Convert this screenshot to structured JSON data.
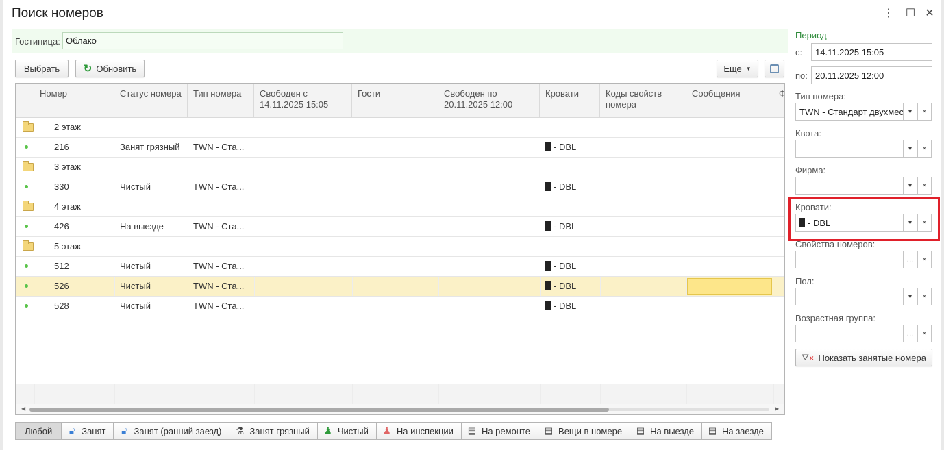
{
  "window": {
    "title": "Поиск номеров"
  },
  "hotel": {
    "label": "Гостиница:",
    "value": "Облако"
  },
  "toolbar": {
    "select_label": "Выбрать",
    "refresh_label": "Обновить",
    "more_label": "Еще"
  },
  "grid": {
    "columns": [
      "Номер",
      "Статус номера",
      "Тип номера",
      "Свободен с\n14.11.2025 15:05",
      "Гости",
      "Свободен по\n20.11.2025 12:00",
      "Кровати",
      "Коды свойств\nномера",
      "Сообщения",
      "Ф"
    ],
    "rows": [
      {
        "kind": "group",
        "number": "2 этаж"
      },
      {
        "kind": "room",
        "number": "216",
        "status": "Занят грязный",
        "type": "TWN - Ста...",
        "beds": "- DBL"
      },
      {
        "kind": "group",
        "number": "3 этаж"
      },
      {
        "kind": "room",
        "number": "330",
        "status": "Чистый",
        "type": "TWN - Ста...",
        "beds": "- DBL"
      },
      {
        "kind": "group",
        "number": "4 этаж"
      },
      {
        "kind": "room",
        "number": "426",
        "status": "На выезде",
        "type": "TWN - Ста...",
        "beds": "- DBL"
      },
      {
        "kind": "group",
        "number": "5 этаж"
      },
      {
        "kind": "room",
        "number": "512",
        "status": "Чистый",
        "type": "TWN - Ста...",
        "beds": "- DBL"
      },
      {
        "kind": "room",
        "number": "526",
        "status": "Чистый",
        "type": "TWN - Ста...",
        "beds": "- DBL"
      },
      {
        "kind": "room",
        "number": "528",
        "status": "Чистый",
        "type": "TWN - Ста...",
        "beds": "- DBL"
      }
    ]
  },
  "filters": [
    {
      "label": "Любой",
      "icon": ""
    },
    {
      "label": "Занят",
      "icon": "occupied-icon"
    },
    {
      "label": "Занят (ранний заезд)",
      "icon": "occupied-early-icon"
    },
    {
      "label": "Занят грязный",
      "icon": "dirty-icon"
    },
    {
      "label": "Чистый",
      "icon": "clean-icon"
    },
    {
      "label": "На инспекции",
      "icon": "inspection-icon"
    },
    {
      "label": "На ремонте",
      "icon": "repair-icon"
    },
    {
      "label": "Вещи в номере",
      "icon": "items-icon"
    },
    {
      "label": "На выезде",
      "icon": "checkout-icon"
    },
    {
      "label": "На заезде",
      "icon": "checkin-icon"
    }
  ],
  "sidebar": {
    "period_label": "Период",
    "from_label": "с:",
    "from_value": "14.11.2025 15:05",
    "to_label": "по:",
    "to_value": "20.11.2025 12:00",
    "room_type_label": "Тип номера:",
    "room_type_value": "TWN - Стандарт двухмест",
    "quota_label": "Квота:",
    "quota_value": "",
    "company_label": "Фирма:",
    "company_value": "",
    "beds_label": "Кровати:",
    "beds_value": "- DBL",
    "props_label": "Свойства номеров:",
    "props_value": "",
    "gender_label": "Пол:",
    "gender_value": "",
    "age_label": "Возрастная группа:",
    "age_value": "",
    "show_occupied_label": "Показать занятые номера"
  },
  "colors": {
    "accent_green": "#2e8b3a",
    "highlight_red": "#e0202a",
    "selected_row": "#fbf1c7"
  }
}
